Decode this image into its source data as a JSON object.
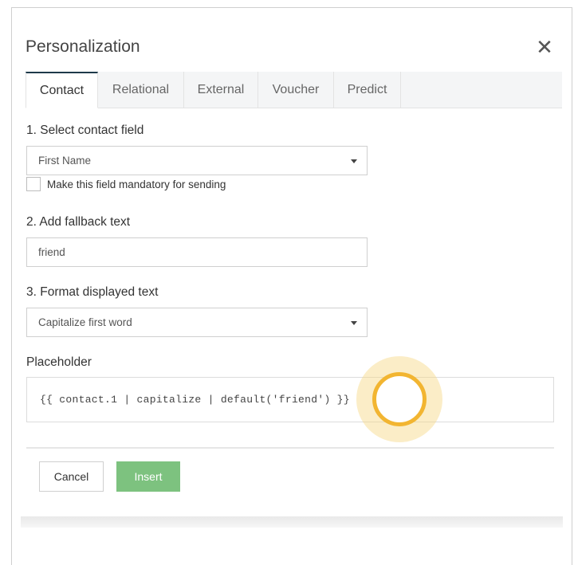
{
  "dialog": {
    "title": "Personalization",
    "close_icon": "close-icon"
  },
  "tabs": [
    {
      "label": "Contact",
      "active": true
    },
    {
      "label": "Relational",
      "active": false
    },
    {
      "label": "External",
      "active": false
    },
    {
      "label": "Voucher",
      "active": false
    },
    {
      "label": "Predict",
      "active": false
    }
  ],
  "contact_field": {
    "label": "1. Select contact field",
    "selected": "First Name",
    "mandatory_checkbox_label": "Make this field mandatory for sending",
    "mandatory_checked": false
  },
  "fallback": {
    "label": "2. Add fallback text",
    "value": "friend"
  },
  "format": {
    "label": "3. Format displayed text",
    "selected": "Capitalize first word"
  },
  "placeholder": {
    "label": "Placeholder",
    "code": "{{ contact.1 | capitalize | default('friend') }}"
  },
  "actions": {
    "cancel_label": "Cancel",
    "insert_label": "Insert"
  },
  "colors": {
    "insert_button": "#7dc27f",
    "active_tab_border": "#1e3a4a",
    "cursor_highlight": "#f2b531"
  }
}
